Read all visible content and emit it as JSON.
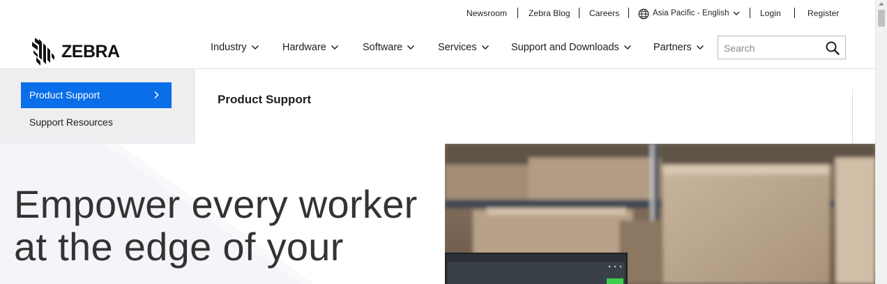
{
  "utility_nav": {
    "newsroom": "Newsroom",
    "blog": "Zebra Blog",
    "careers": "Careers",
    "region": "Asia Pacific - English",
    "login": "Login",
    "register": "Register"
  },
  "brand": {
    "name": "ZEBRA"
  },
  "main_nav": {
    "items": [
      {
        "label": "Industry"
      },
      {
        "label": "Hardware"
      },
      {
        "label": "Software"
      },
      {
        "label": "Services"
      },
      {
        "label": "Support and Downloads"
      },
      {
        "label": "Partners"
      }
    ]
  },
  "search": {
    "placeholder": "Search"
  },
  "support_menu": {
    "active": "Product Support",
    "secondary": "Support Resources",
    "content_title": "Product Support"
  },
  "hero": {
    "heading": "Empower every worker at the edge of your"
  },
  "colors": {
    "accent": "#0a6ee8",
    "panel": "#eeeef1",
    "text": "#1d1d1d"
  },
  "icons": [
    "globe-icon",
    "chevron-down-icon",
    "search-icon",
    "chevron-right-icon",
    "zebra-logo-icon"
  ]
}
